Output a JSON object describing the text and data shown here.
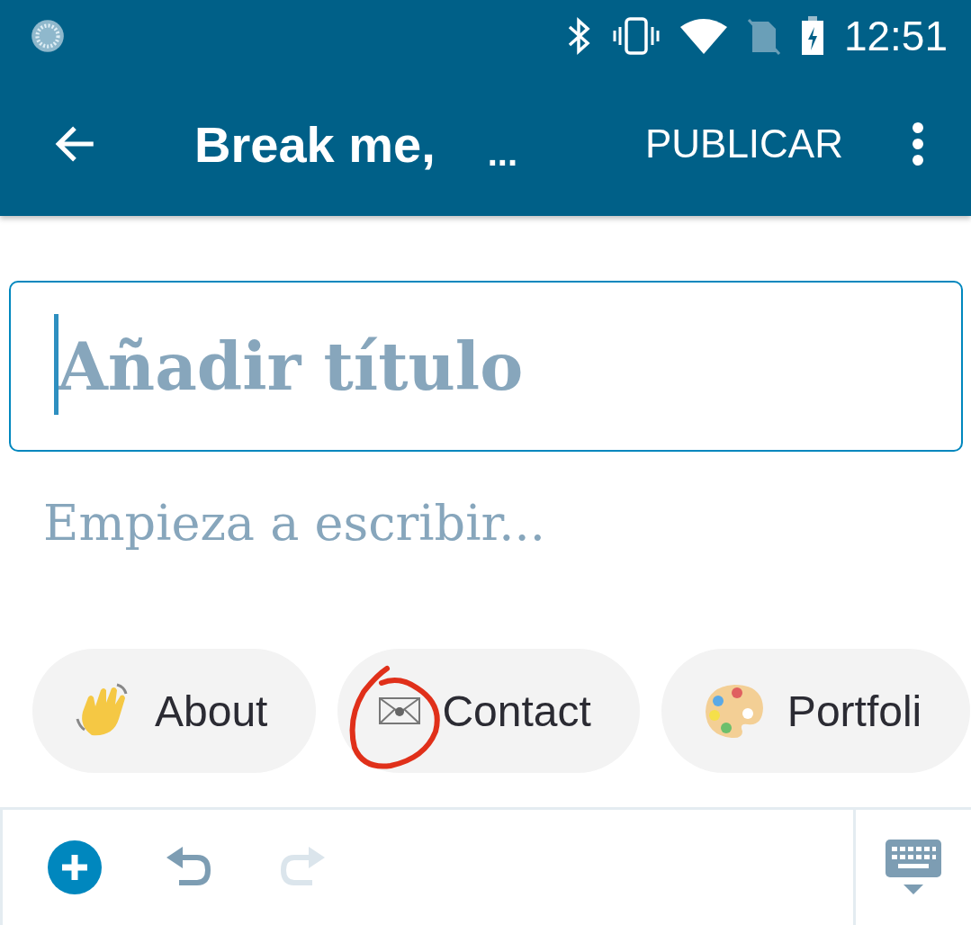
{
  "status_bar": {
    "time": "12:51"
  },
  "app_bar": {
    "title": "Break me,",
    "title_ellipsis": "...",
    "action": "PUBLICAR"
  },
  "editor": {
    "title_placeholder": "Añadir título",
    "body_placeholder": "Empieza a escribir..."
  },
  "suggestions": [
    {
      "kind": "wave",
      "label": "About"
    },
    {
      "kind": "envelope",
      "label": "Contact"
    },
    {
      "kind": "palette",
      "label": "Portfoli"
    }
  ],
  "toolbar": {
    "undo_disabled": false,
    "redo_disabled": true
  }
}
